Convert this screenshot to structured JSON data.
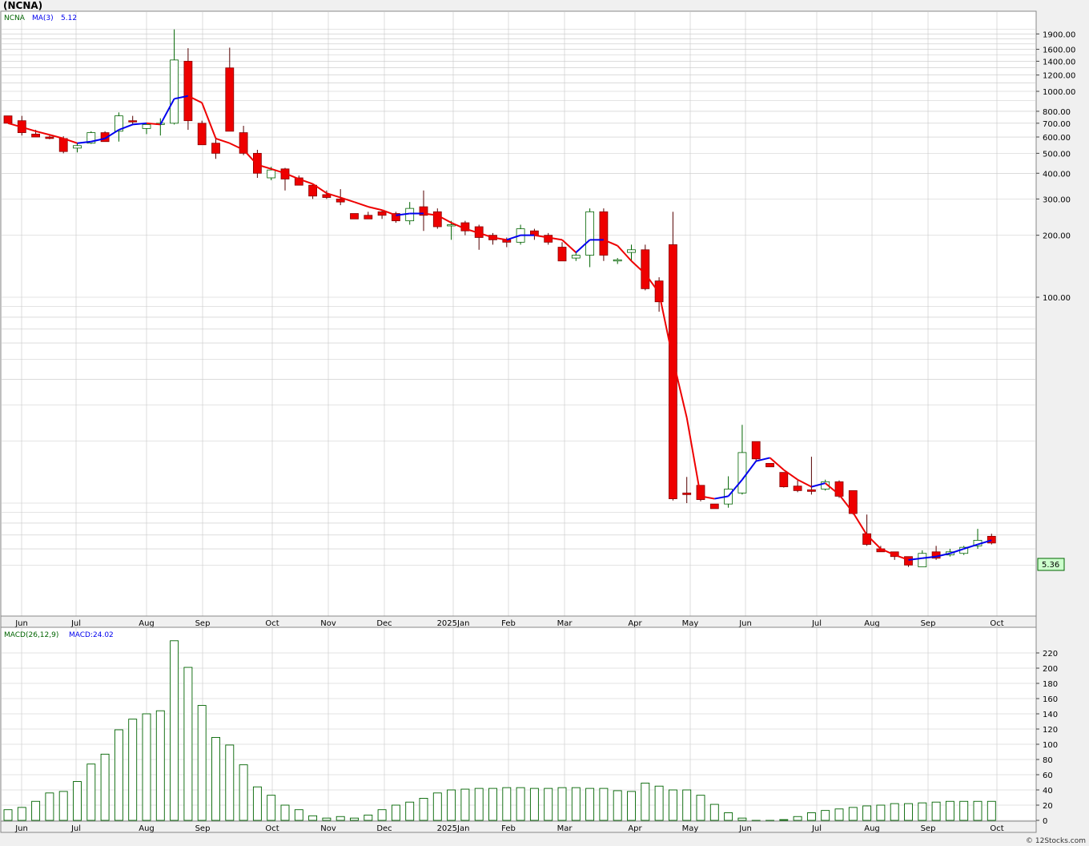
{
  "title": "(NCNA)",
  "footer": "© 12Stocks.com",
  "price_panel": {
    "symbol_label": "NCNA",
    "ma_label": "MA(3)",
    "ma_value": "5.12",
    "last_price_label": "5.36",
    "y_tick_labels": [
      "1900.00",
      "1600.00",
      "1400.00",
      "1200.00",
      "1000.00",
      "800.00",
      "700.00",
      "600.00",
      "500.00",
      "400.00",
      "300.00",
      "200.00",
      "100.00"
    ]
  },
  "macd_panel": {
    "label": "MACD(26,12,9)",
    "value_label": "MACD:24.02",
    "y_tick_labels": [
      "220",
      "200",
      "180",
      "160",
      "140",
      "120",
      "100",
      "80",
      "60",
      "40",
      "20",
      "0"
    ]
  },
  "x_month_labels": [
    "Jun",
    "Jul",
    "Aug",
    "Sep",
    "Oct",
    "Nov",
    "Dec",
    "2025Jan",
    "Feb",
    "Mar",
    "Apr",
    "May",
    "Jun",
    "Jul",
    "Aug",
    "Sep",
    "Oct"
  ],
  "colors": {
    "up_candle_border": "#006400",
    "down_candle_fill": "#ee0000",
    "ma_rising": "#0000ee",
    "ma_falling": "#ee0000",
    "macd_bar": "#006400",
    "grid": "#c8c8c8",
    "price_label_bg": "#ccffcc"
  },
  "chart_data": [
    {
      "type": "candlestick",
      "title": "(NCNA)",
      "y_scale": "log",
      "y_range": [
        4.5,
        2100
      ],
      "interval": "weekly",
      "x_labels": [
        "Jun",
        "Jul",
        "Aug",
        "Sep",
        "Oct",
        "Nov",
        "Dec",
        "2025Jan",
        "Feb",
        "Mar",
        "Apr",
        "May",
        "Jun",
        "Jul",
        "Aug",
        "Sep",
        "Oct"
      ],
      "ohlc": [
        [
          760,
          760,
          700,
          700
        ],
        [
          720,
          760,
          610,
          630
        ],
        [
          620,
          650,
          600,
          600
        ],
        [
          600,
          610,
          585,
          590
        ],
        [
          590,
          605,
          500,
          510
        ],
        [
          530,
          560,
          505,
          545
        ],
        [
          560,
          640,
          555,
          630
        ],
        [
          630,
          640,
          570,
          570
        ],
        [
          640,
          790,
          570,
          760
        ],
        [
          720,
          760,
          690,
          710
        ],
        [
          660,
          700,
          620,
          690
        ],
        [
          690,
          740,
          610,
          700
        ],
        [
          700,
          2000,
          690,
          1420
        ],
        [
          1400,
          1620,
          650,
          720
        ],
        [
          700,
          720,
          550,
          550
        ],
        [
          560,
          600,
          470,
          500
        ],
        [
          1300,
          1630,
          640,
          640
        ],
        [
          630,
          680,
          490,
          500
        ],
        [
          500,
          520,
          380,
          400
        ],
        [
          380,
          430,
          370,
          415
        ],
        [
          420,
          425,
          330,
          375
        ],
        [
          380,
          390,
          350,
          350
        ],
        [
          350,
          355,
          300,
          310
        ],
        [
          315,
          330,
          300,
          305
        ],
        [
          300,
          335,
          280,
          290
        ],
        [
          255,
          255,
          240,
          240
        ],
        [
          250,
          260,
          240,
          240
        ],
        [
          260,
          265,
          240,
          250
        ],
        [
          255,
          260,
          230,
          235
        ],
        [
          235,
          290,
          225,
          270
        ],
        [
          275,
          330,
          210,
          250
        ],
        [
          260,
          270,
          215,
          220
        ],
        [
          225,
          235,
          190,
          225
        ],
        [
          230,
          235,
          200,
          210
        ],
        [
          220,
          225,
          170,
          195
        ],
        [
          200,
          205,
          180,
          190
        ],
        [
          190,
          195,
          175,
          185
        ],
        [
          185,
          225,
          180,
          215
        ],
        [
          210,
          215,
          190,
          200
        ],
        [
          200,
          205,
          180,
          185
        ],
        [
          175,
          185,
          150,
          150
        ],
        [
          155,
          165,
          150,
          160
        ],
        [
          160,
          270,
          140,
          260
        ],
        [
          260,
          270,
          150,
          160
        ],
        [
          150,
          155,
          145,
          152
        ],
        [
          165,
          180,
          150,
          170
        ],
        [
          170,
          180,
          108,
          110
        ],
        [
          120,
          125,
          85,
          95
        ],
        [
          180,
          260,
          10.3,
          10.5
        ],
        [
          11.2,
          13.4,
          10.0,
          11.0
        ],
        [
          12.2,
          12.2,
          10.2,
          10.4
        ],
        [
          9.9,
          9.9,
          9.4,
          9.4
        ],
        [
          9.9,
          13.5,
          9.5,
          11.7
        ],
        [
          11.2,
          24.0,
          11.0,
          17.6
        ],
        [
          19.9,
          19.9,
          16.0,
          16.4
        ],
        [
          15.6,
          15.6,
          15.0,
          15.0
        ],
        [
          14.1,
          14.1,
          11.9,
          12.0
        ],
        [
          12.1,
          12.9,
          11.3,
          11.5
        ],
        [
          11.6,
          16.8,
          11.0,
          11.4
        ],
        [
          11.7,
          13.0,
          11.5,
          12.7
        ],
        [
          12.7,
          12.9,
          10.6,
          10.8
        ],
        [
          11.5,
          11.5,
          8.8,
          8.9
        ],
        [
          7.1,
          8.8,
          6.2,
          6.3
        ],
        [
          6.0,
          6.2,
          5.8,
          5.8
        ],
        [
          5.8,
          5.8,
          5.3,
          5.5
        ],
        [
          5.5,
          5.5,
          4.9,
          5.0
        ],
        [
          4.9,
          5.9,
          4.9,
          5.7
        ],
        [
          5.8,
          6.2,
          5.3,
          5.4
        ],
        [
          5.6,
          6.0,
          5.5,
          5.8
        ],
        [
          5.7,
          6.2,
          5.6,
          6.1
        ],
        [
          6.2,
          7.5,
          6.0,
          6.6
        ],
        [
          6.9,
          7.1,
          6.3,
          6.4
        ]
      ],
      "ma3": [
        700,
        670,
        640,
        615,
        590,
        560,
        570,
        590,
        650,
        690,
        700,
        690,
        920,
        950,
        880,
        590,
        560,
        520,
        440,
        420,
        400,
        375,
        355,
        320,
        305,
        290,
        275,
        265,
        250,
        255,
        255,
        250,
        230,
        215,
        205,
        195,
        190,
        200,
        200,
        195,
        190,
        165,
        190,
        190,
        178,
        150,
        130,
        105,
        50,
        26,
        10.8,
        10.5,
        10.8,
        13.0,
        16.0,
        16.6,
        14.5,
        13.0,
        12.0,
        12.5,
        11.0,
        9.0,
        7.0,
        6.0,
        5.6,
        5.3,
        5.4,
        5.5,
        5.7,
        6.0,
        6.3,
        6.6
      ],
      "ma_label": "MA(3)",
      "ma_last_value": 5.12,
      "last_price": 5.36
    },
    {
      "type": "bar",
      "title": "MACD(26,12,9)",
      "y_range": [
        0,
        240
      ],
      "x_labels": [
        "Jun",
        "Jul",
        "Aug",
        "Sep",
        "Oct",
        "Nov",
        "Dec",
        "2025Jan",
        "Feb",
        "Mar",
        "Apr",
        "May",
        "Jun",
        "Jul",
        "Aug",
        "Sep",
        "Oct"
      ],
      "values": [
        14,
        17,
        25,
        36,
        38,
        51,
        74,
        87,
        119,
        133,
        140,
        144,
        236,
        201,
        151,
        109,
        99,
        73,
        44,
        33,
        20,
        14,
        6,
        3,
        5,
        3,
        7,
        14,
        20,
        24,
        29,
        36,
        40,
        41,
        42,
        42,
        43,
        43,
        42,
        42,
        43,
        43,
        42,
        42,
        39,
        38,
        49,
        45,
        40,
        40,
        33,
        21,
        10,
        3,
        0,
        0,
        1,
        5,
        10,
        13,
        15,
        17,
        19,
        20,
        22,
        22,
        23,
        24,
        25,
        25,
        25,
        25,
        25,
        25,
        25,
        25,
        25,
        25,
        24,
        25
      ],
      "value_label": "MACD:24.02"
    }
  ]
}
